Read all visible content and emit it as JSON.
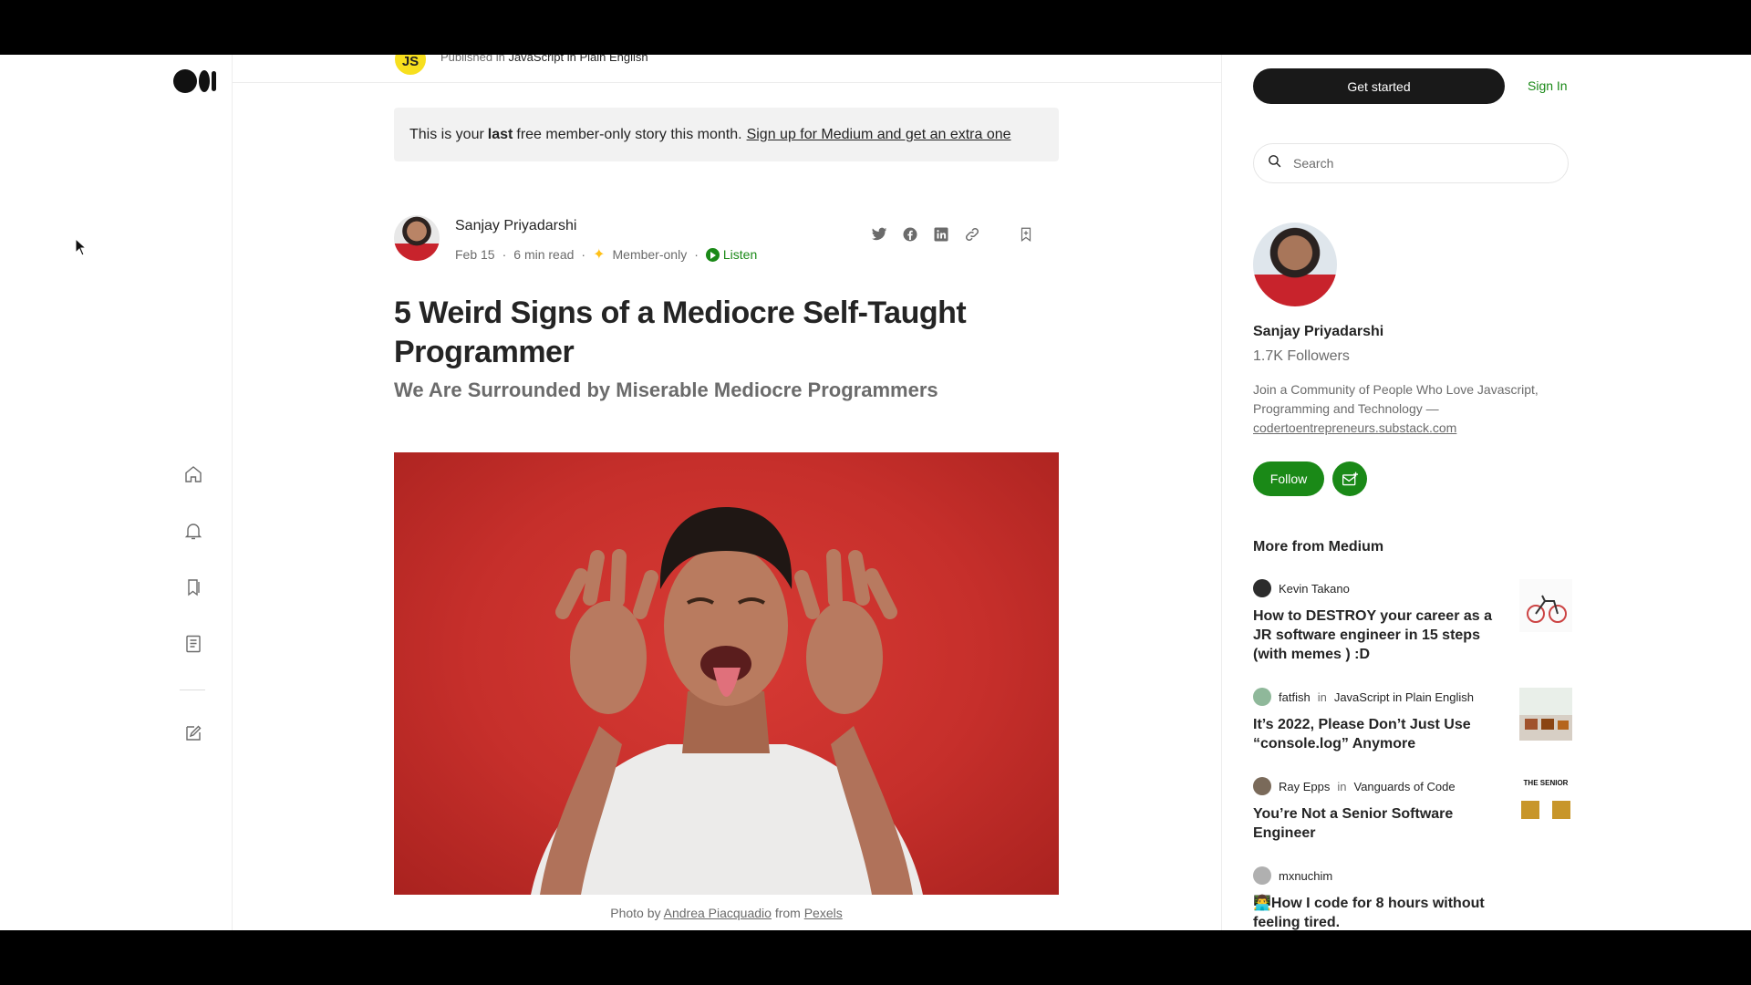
{
  "publication": {
    "avatar_text": "JS",
    "published_in": "Published in",
    "name": "JavaScript in Plain English"
  },
  "banner": {
    "text_before": "This is your",
    "bold": "last",
    "text_after": "free member-only story this month.",
    "link": "Sign up for Medium and get an extra one"
  },
  "article": {
    "author": "Sanjay Priyadarshi",
    "date": "Feb 15",
    "read_time": "6 min read",
    "dot": "·",
    "member_only": "Member-only",
    "listen": "Listen",
    "title": "5 Weird Signs of a Mediocre Self-Taught Programmer",
    "subtitle": "We Are Surrounded by Miserable Mediocre Programmers",
    "caption": {
      "prefix": "Photo by",
      "photographer": "Andrea Piacquadio",
      "middle": "from",
      "source": "Pexels"
    }
  },
  "sidebar": {
    "get_started": "Get started",
    "sign_in": "Sign In",
    "search_placeholder": "Search",
    "author_name": "Sanjay Priyadarshi",
    "followers": "1.7K Followers",
    "bio": "Join a Community of People Who Love Javascript, Programming and Technology —",
    "bio_link": "codertoentrepreneurs.substack.com",
    "follow": "Follow",
    "more_heading": "More from Medium",
    "in_word": "in",
    "recommendations": [
      {
        "author": "Kevin Takano",
        "publication": "",
        "title": "How to DESTROY your career as a JR software engineer in 15 steps (with memes ) :D"
      },
      {
        "author": "fatfish",
        "publication": "JavaScript in Plain English",
        "title": "It’s 2022, Please Don’t Just Use “console.log” Anymore"
      },
      {
        "author": "Ray Epps",
        "publication": "Vanguards of Code",
        "title": "You’re Not a Senior Software Engineer",
        "thumb_text": "THE SENIOR"
      },
      {
        "author": "mxnuchim",
        "publication": "",
        "title": "👨‍💻How I code for 8 hours without feeling tired."
      }
    ]
  },
  "colors": {
    "accent_green": "#1a8917",
    "star_gold": "#ffc017",
    "hero_red": "#c62f2b"
  }
}
